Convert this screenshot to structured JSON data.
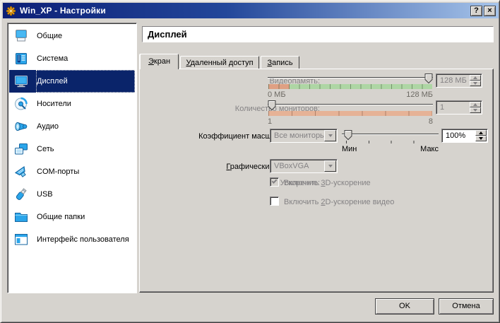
{
  "window": {
    "title": "Win_XP - Настройки",
    "help_button": "?",
    "close_button": "×"
  },
  "sidebar": {
    "items": [
      {
        "label": "Общие"
      },
      {
        "label": "Система"
      },
      {
        "label": "Дисплей",
        "selected": true
      },
      {
        "label": "Носители"
      },
      {
        "label": "Аудио"
      },
      {
        "label": "Сеть"
      },
      {
        "label": "COM-порты"
      },
      {
        "label": "USB"
      },
      {
        "label": "Общие папки"
      },
      {
        "label": "Интерфейс пользователя"
      }
    ]
  },
  "header": {
    "title": "Дисплей"
  },
  "tabs": [
    {
      "text": "Экран",
      "u": 0,
      "active": true
    },
    {
      "text": "Удаленный доступ",
      "u": 0
    },
    {
      "text": "Запись",
      "u": 0
    }
  ],
  "screen_tab": {
    "video_memory": {
      "label": {
        "text": "Видеопамять:",
        "u": 0
      },
      "scale_min": "0 МБ",
      "scale_max": "128 МБ",
      "value": "128 МБ",
      "enabled": false
    },
    "monitor_count": {
      "label": {
        "text": "Количество мониторов:",
        "u": 11
      },
      "scale_min": "1",
      "scale_max": "8",
      "value": "1",
      "enabled": false
    },
    "scale_factor": {
      "label": "Коэффициент масштабирования:",
      "dropdown_value": "Все мониторы",
      "scale_min": "Мин",
      "scale_max": "Макс",
      "value": "100%",
      "enabled": true
    },
    "graphics_controller": {
      "label": {
        "text": "Графический контроллер:",
        "u": 0
      },
      "dropdown_value": "VBoxVGA"
    },
    "acceleration": {
      "label": "Ускорение:",
      "checkbox_3d": {
        "text": "Включить 3D-ускорение",
        "u": 9,
        "checked": true
      },
      "checkbox_2d": {
        "text": "Включить 2D-ускорение видео",
        "u": 9,
        "checked": false
      }
    }
  },
  "footer": {
    "ok": "OK",
    "cancel": "Отмена"
  },
  "colors": {
    "dialog_bg": "#d6d3ce",
    "titlebar_left": "#0c1f77",
    "titlebar_right": "#a6c4ea",
    "selection_bg": "#0a246a",
    "gauge_green": "#aed6a4",
    "gauge_orange": "#dfa083",
    "gauge_monitors": "#e6b296",
    "disabled_text": "#848284"
  }
}
